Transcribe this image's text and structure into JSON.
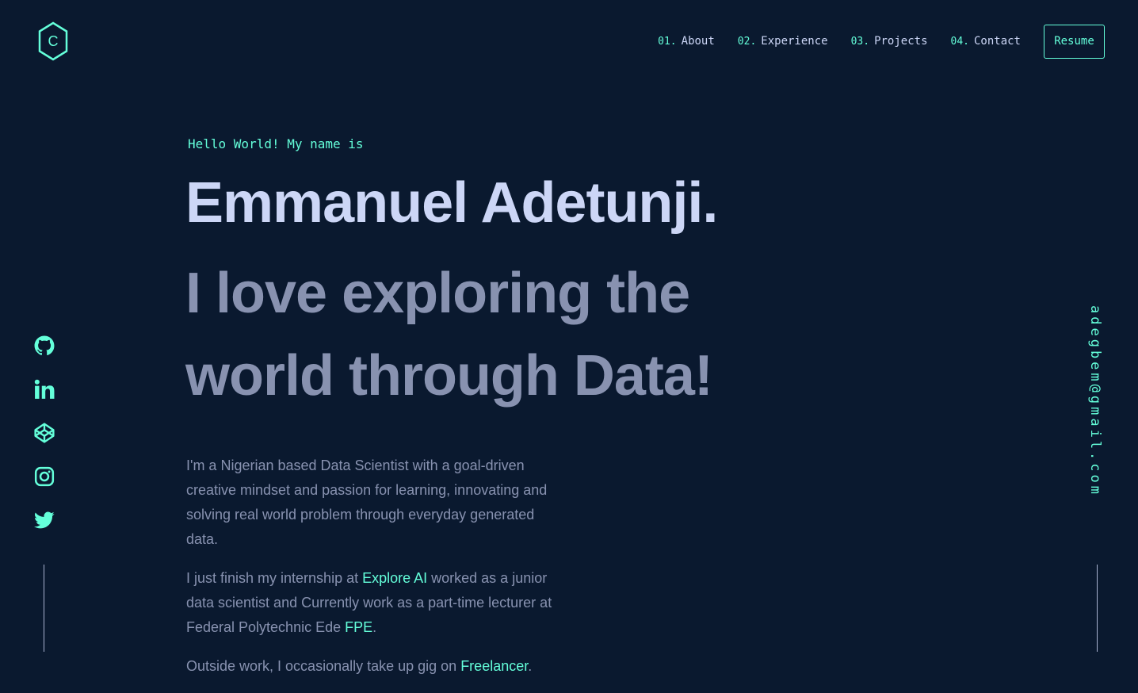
{
  "header": {
    "logo_letter": "C",
    "nav": [
      {
        "num": "01.",
        "label": "About"
      },
      {
        "num": "02.",
        "label": "Experience"
      },
      {
        "num": "03.",
        "label": "Projects"
      },
      {
        "num": "04.",
        "label": "Contact"
      }
    ],
    "resume_label": "Resume"
  },
  "hero": {
    "greeting": "Hello World! My name is",
    "name": "Emmanuel Adetunji.",
    "tagline": "I love exploring the world through Data!",
    "bio": {
      "p1": "I'm a Nigerian based Data Scientist with a goal-driven creative mindset and passion for learning, innovating and solving real world problem through everyday generated data.",
      "p2_before": "I just finish my internship at ",
      "p2_link1": "Explore AI",
      "p2_middle": " worked as a junior data scientist and Currently work as a part-time lecturer at Federal Polytechnic Ede ",
      "p2_link2": "FPE",
      "p2_after": ".",
      "p3_before": "Outside work, I occasionally take up gig on ",
      "p3_link": "Freelancer",
      "p3_after": "."
    }
  },
  "socials": [
    "github-icon",
    "linkedin-icon",
    "codepen-icon",
    "instagram-icon",
    "twitter-icon"
  ],
  "email": "adegbem@gmail.com",
  "colors": {
    "background": "#0a192f",
    "accent": "#64ffda",
    "heading": "#ccd6f6",
    "body_text": "#8892b0"
  }
}
